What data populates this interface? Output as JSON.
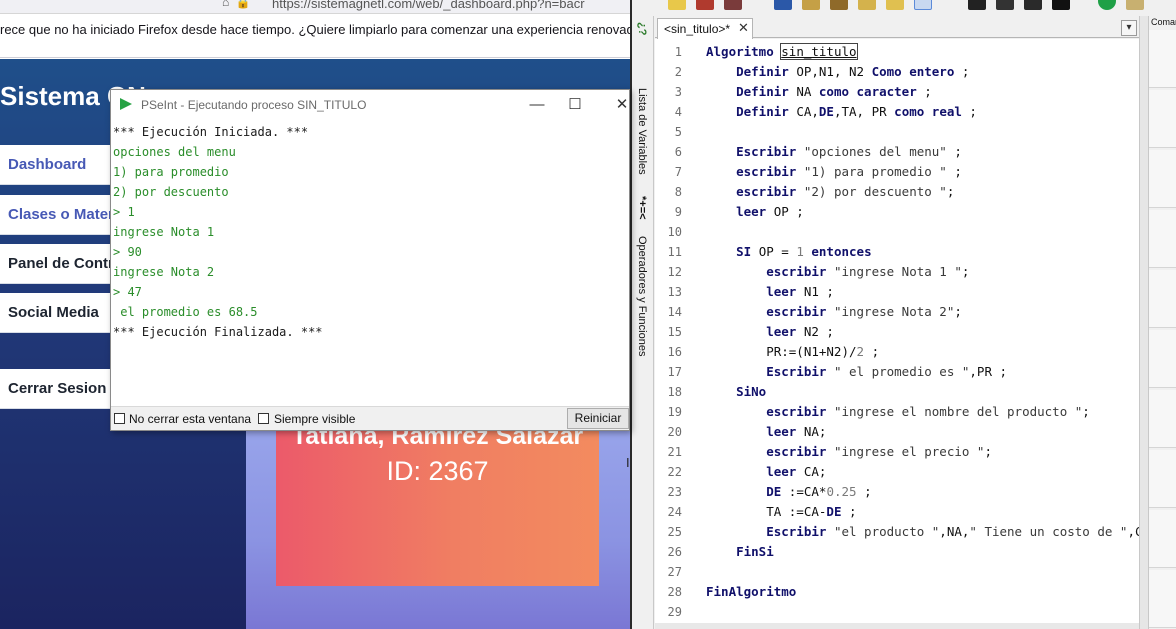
{
  "firefox": {
    "url": "https://sistemagnetl.com/web/_dashboard.php?n=bacr",
    "notification": "rece que no ha iniciado Firefox desde hace tiempo. ¿Quiere limpiarlo para comenzar una experiencia renovada? ¡A propó"
  },
  "website": {
    "brand": "Sistema GN",
    "nav": [
      {
        "label": "Dashboard"
      },
      {
        "label": "Clases o Mater"
      },
      {
        "label": "Panel de Contr"
      },
      {
        "label": "Social Media"
      },
      {
        "label": "Cerrar Sesion"
      }
    ],
    "profile": {
      "name": "Tatiana, Ramirez Salazar",
      "id": "ID: 2367"
    },
    "side_fragment": "I"
  },
  "exec_window": {
    "title": "PSeInt - Ejecutando proceso SIN_TITULO",
    "controls": {
      "minimize": "—",
      "maximize": "☐",
      "close": "✕"
    },
    "console": [
      {
        "text": "*** Ejecución Iniciada. ***",
        "kind": "sys"
      },
      {
        "text": "opciones del menu",
        "kind": "out"
      },
      {
        "text": "1) para promedio",
        "kind": "out"
      },
      {
        "text": "2) por descuento",
        "kind": "out"
      },
      {
        "text": "> 1",
        "kind": "out"
      },
      {
        "text": "ingrese Nota 1",
        "kind": "out"
      },
      {
        "text": "> 90",
        "kind": "out"
      },
      {
        "text": "ingrese Nota 2",
        "kind": "out"
      },
      {
        "text": "> 47",
        "kind": "out"
      },
      {
        "text": " el promedio es 68.5",
        "kind": "out"
      },
      {
        "text": "*** Ejecución Finalizada. ***",
        "kind": "sys"
      }
    ],
    "no_close_label": "No cerrar esta ventana",
    "always_visible_label": "Siempre visible",
    "restart_label": "Reiniciar"
  },
  "ide": {
    "tab_label": "<sin_titulo>*",
    "tab_close": "✕",
    "left_panel": {
      "variables_label": "Lista de Variables",
      "operators_label": "Operadores y Funciones",
      "badge1": "*+=<",
      "badge2": "¿?"
    },
    "commands_title": "Coman",
    "line_numbers": [
      "1",
      "2",
      "3",
      "4",
      "5",
      "6",
      "7",
      "8",
      "9",
      "10",
      "11",
      "12",
      "13",
      "14",
      "15",
      "16",
      "17",
      "18",
      "19",
      "20",
      "21",
      "22",
      "23",
      "24",
      "25",
      "26",
      "27",
      "28",
      "29"
    ],
    "code_lines": [
      [
        {
          "t": "Algoritmo ",
          "c": "kw"
        },
        {
          "t": "sin_titulo",
          "c": "id hl"
        }
      ],
      [
        {
          "t": "    Definir ",
          "c": "kw"
        },
        {
          "t": "OP,N1, N2 ",
          "c": "id"
        },
        {
          "t": "Como entero",
          "c": "kw"
        },
        {
          "t": " ;",
          "c": "id"
        }
      ],
      [
        {
          "t": "    Definir ",
          "c": "kw"
        },
        {
          "t": "NA ",
          "c": "id"
        },
        {
          "t": "como caracter",
          "c": "kw"
        },
        {
          "t": " ;",
          "c": "id"
        }
      ],
      [
        {
          "t": "    Definir ",
          "c": "kw"
        },
        {
          "t": "CA,",
          "c": "id"
        },
        {
          "t": "DE",
          "c": "kw"
        },
        {
          "t": ",TA, PR ",
          "c": "id"
        },
        {
          "t": "como real",
          "c": "kw"
        },
        {
          "t": " ;",
          "c": "id"
        }
      ],
      [],
      [
        {
          "t": "    Escribir ",
          "c": "kw"
        },
        {
          "t": "\"opciones del menu\"",
          "c": "str"
        },
        {
          "t": " ;",
          "c": "id"
        }
      ],
      [
        {
          "t": "    escribir ",
          "c": "kw"
        },
        {
          "t": "\"1) para promedio \"",
          "c": "str"
        },
        {
          "t": " ;",
          "c": "id"
        }
      ],
      [
        {
          "t": "    escribir ",
          "c": "kw"
        },
        {
          "t": "\"2) por descuento \"",
          "c": "str"
        },
        {
          "t": ";",
          "c": "id"
        }
      ],
      [
        {
          "t": "    leer ",
          "c": "kw"
        },
        {
          "t": "OP ;",
          "c": "id"
        }
      ],
      [],
      [
        {
          "t": "    SI ",
          "c": "kw"
        },
        {
          "t": "OP = ",
          "c": "id"
        },
        {
          "t": "1",
          "c": "num"
        },
        {
          "t": " entonces",
          "c": "kw"
        }
      ],
      [
        {
          "t": "        escribir ",
          "c": "kw"
        },
        {
          "t": "\"ingrese Nota 1 \"",
          "c": "str"
        },
        {
          "t": ";",
          "c": "id"
        }
      ],
      [
        {
          "t": "        leer ",
          "c": "kw"
        },
        {
          "t": "N1 ;",
          "c": "id"
        }
      ],
      [
        {
          "t": "        escribir ",
          "c": "kw"
        },
        {
          "t": "\"ingrese Nota 2\"",
          "c": "str"
        },
        {
          "t": ";",
          "c": "id"
        }
      ],
      [
        {
          "t": "        leer ",
          "c": "kw"
        },
        {
          "t": "N2 ;",
          "c": "id"
        }
      ],
      [
        {
          "t": "        PR:=(N1+N2)/",
          "c": "id"
        },
        {
          "t": "2",
          "c": "num"
        },
        {
          "t": " ;",
          "c": "id"
        }
      ],
      [
        {
          "t": "        Escribir ",
          "c": "kw"
        },
        {
          "t": "\" el promedio es \"",
          "c": "str"
        },
        {
          "t": ",PR ;",
          "c": "id"
        }
      ],
      [
        {
          "t": "    SiNo",
          "c": "kw"
        }
      ],
      [
        {
          "t": "        escribir ",
          "c": "kw"
        },
        {
          "t": "\"ingrese el nombre del producto \"",
          "c": "str"
        },
        {
          "t": ";",
          "c": "id"
        }
      ],
      [
        {
          "t": "        leer ",
          "c": "kw"
        },
        {
          "t": "NA;",
          "c": "id"
        }
      ],
      [
        {
          "t": "        escribir ",
          "c": "kw"
        },
        {
          "t": "\"ingrese el precio \"",
          "c": "str"
        },
        {
          "t": ";",
          "c": "id"
        }
      ],
      [
        {
          "t": "        leer ",
          "c": "kw"
        },
        {
          "t": "CA;",
          "c": "id"
        }
      ],
      [
        {
          "t": "        DE ",
          "c": "kw"
        },
        {
          "t": ":=CA*",
          "c": "id"
        },
        {
          "t": "0.25",
          "c": "num"
        },
        {
          "t": " ;",
          "c": "id"
        }
      ],
      [
        {
          "t": "        TA :=CA-",
          "c": "id"
        },
        {
          "t": "DE",
          "c": "kw"
        },
        {
          "t": " ;",
          "c": "id"
        }
      ],
      [
        {
          "t": "        Escribir ",
          "c": "kw"
        },
        {
          "t": "\"el producto \"",
          "c": "str"
        },
        {
          "t": ",NA,",
          "c": "id"
        },
        {
          "t": "\" Tiene un costo de \"",
          "c": "str"
        },
        {
          "t": ",CA",
          "c": "id"
        }
      ],
      [
        {
          "t": "    FinSi",
          "c": "kw"
        }
      ],
      [],
      [
        {
          "t": "FinAlgoritmo",
          "c": "kw"
        }
      ],
      []
    ]
  },
  "colors": {
    "keyword": "#10106a",
    "console_output": "#2a8d2a",
    "profile_gradient_start": "#ec5a6a",
    "profile_gradient_end": "#f38b5f",
    "site_sidebar": "#1f4f8a"
  }
}
